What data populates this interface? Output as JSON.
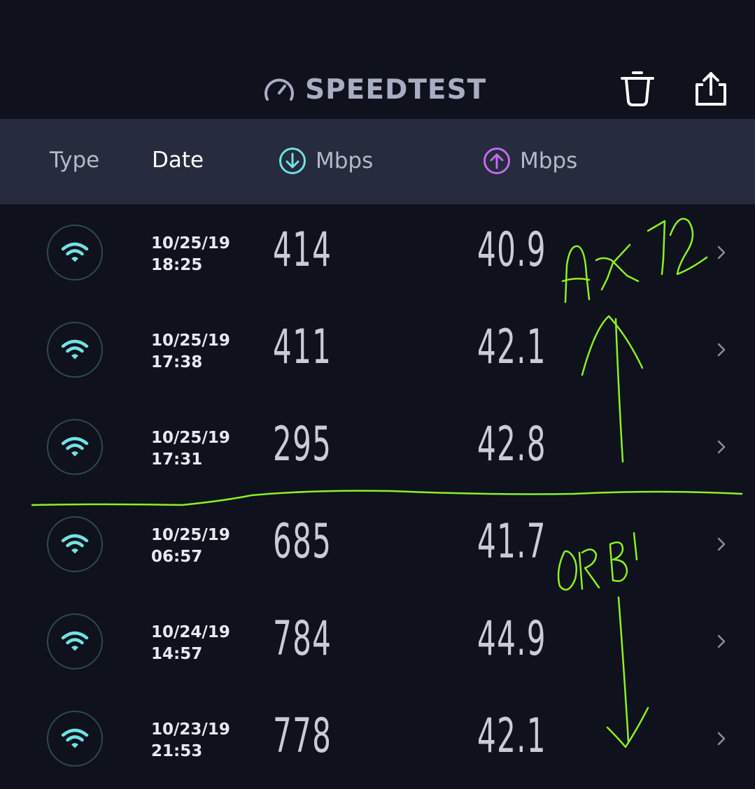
{
  "app": {
    "title": "SPEEDTEST",
    "icons": {
      "logo": "speedometer-icon",
      "delete": "trash-icon",
      "share": "share-icon"
    }
  },
  "columns": {
    "type": "Type",
    "date": "Date",
    "download_unit": "Mbps",
    "upload_unit": "Mbps",
    "download_icon": "download-arrow-icon",
    "upload_icon": "upload-arrow-icon"
  },
  "results": [
    {
      "connection": "wifi-icon",
      "date": "10/25/19",
      "time": "18:25",
      "download": "414",
      "upload": "40.9"
    },
    {
      "connection": "wifi-icon",
      "date": "10/25/19",
      "time": "17:38",
      "download": "411",
      "upload": "42.1"
    },
    {
      "connection": "wifi-icon",
      "date": "10/25/19",
      "time": "17:31",
      "download": "295",
      "upload": "42.8"
    },
    {
      "connection": "wifi-icon",
      "date": "10/25/19",
      "time": "06:57",
      "download": "685",
      "upload": "41.7"
    },
    {
      "connection": "wifi-icon",
      "date": "10/24/19",
      "time": "14:57",
      "download": "784",
      "upload": "44.9"
    },
    {
      "connection": "wifi-icon",
      "date": "10/23/19",
      "time": "21:53",
      "download": "778",
      "upload": "42.1"
    }
  ],
  "annotations": {
    "upper_label": "AX12",
    "lower_label": "ORBI"
  },
  "colors": {
    "background": "#0f111d",
    "header_background": "#262b3d",
    "download_accent": "#6fe3e3",
    "upload_accent": "#c36cf0",
    "ink": "#8cf21e"
  }
}
